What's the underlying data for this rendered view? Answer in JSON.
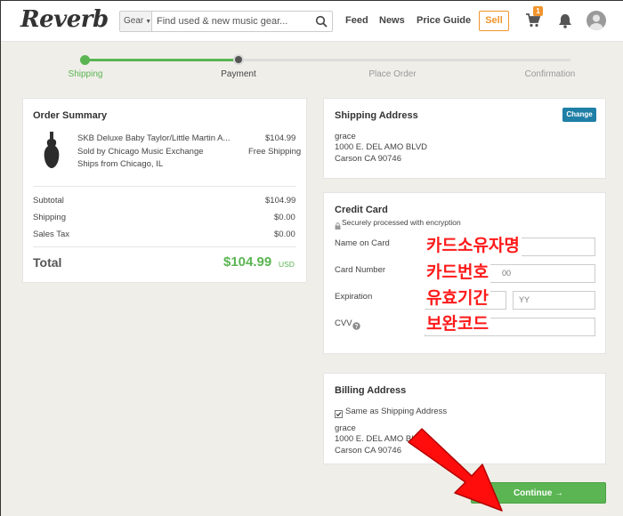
{
  "header": {
    "logo": "Reverb",
    "search": {
      "category": "Gear",
      "placeholder": "Find used & new music gear..."
    },
    "nav": [
      "Feed",
      "News",
      "Price Guide"
    ],
    "sell_label": "Sell",
    "cart_count": "1"
  },
  "progress": {
    "steps": [
      "Shipping",
      "Payment",
      "Place Order",
      "Confirmation"
    ],
    "active_step": 2,
    "accent": "#5ab552"
  },
  "order_summary": {
    "title": "Order Summary",
    "item": {
      "name": "SKB Deluxe Baby Taylor/Little Martin A...",
      "seller": "Sold by Chicago Music Exchange",
      "ships_from": "Ships from Chicago, IL",
      "price": "$104.99",
      "shipping": "Free Shipping"
    },
    "rows": [
      {
        "label": "Subtotal",
        "value": "$104.99"
      },
      {
        "label": "Shipping",
        "value": "$0.00"
      },
      {
        "label": "Sales Tax",
        "value": "$0.00"
      }
    ],
    "total_label": "Total",
    "total_value": "$104.99",
    "currency": "USD"
  },
  "shipping_address": {
    "title": "Shipping Address",
    "change_label": "Change",
    "lines": [
      "grace",
      "1000 E. DEL AMO BLVD",
      "Carson CA 90746"
    ]
  },
  "credit_card": {
    "title": "Credit Card",
    "secure_note": "Securely processed with encryption",
    "name_label": "Name on Card",
    "number_label": "Card Number",
    "number_fragment": "00",
    "expiration_label": "Expiration",
    "year_placeholder": "YY",
    "cvv_label": "CVV"
  },
  "billing_address": {
    "title": "Billing Address",
    "same_as_label": "Same as Shipping Address",
    "lines": [
      "grace",
      "1000 E. DEL AMO BLVD",
      "Carson CA 90746"
    ]
  },
  "annotations": {
    "name": "카드소유자명",
    "number": "카드번호",
    "expiration": "유효기간",
    "cvv": "보완코드"
  },
  "continue_label": "Continue →"
}
